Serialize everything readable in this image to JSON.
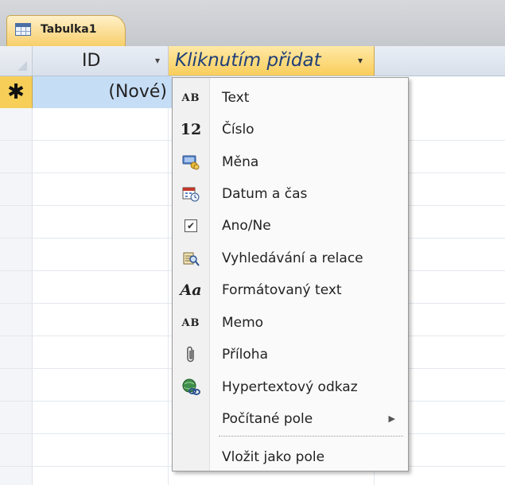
{
  "tab": {
    "label": "Tabulka1",
    "icon": "table-icon"
  },
  "header": {
    "id_label": "ID",
    "add_label": "Kliknutím přidat",
    "arrow": "▾"
  },
  "new_row": {
    "marker": "✱",
    "value": "(Nové)"
  },
  "menu": {
    "items": [
      {
        "label": "Text",
        "icon": "text-type-icon",
        "glyph": "AB"
      },
      {
        "label": "Číslo",
        "icon": "number-type-icon",
        "glyph": "12"
      },
      {
        "label": "Měna",
        "icon": "currency-icon",
        "glyph": "💳"
      },
      {
        "label": "Datum a čas",
        "icon": "calendar-clock-icon",
        "glyph": "📅"
      },
      {
        "label": "Ano/Ne",
        "icon": "checkbox-icon",
        "glyph": "✔"
      },
      {
        "label": "Vyhledávání a relace",
        "icon": "lookup-icon",
        "glyph": "🔍"
      },
      {
        "label": "Formátovaný text",
        "icon": "rich-text-icon",
        "glyph": "Aa"
      },
      {
        "label": "Memo",
        "icon": "memo-icon",
        "glyph": "AB"
      },
      {
        "label": "Příloha",
        "icon": "paperclip-icon",
        "glyph": "📎"
      },
      {
        "label": "Hypertextový odkaz",
        "icon": "hyperlink-icon",
        "glyph": "🔗"
      },
      {
        "label": "Počítané pole",
        "icon": "",
        "glyph": "",
        "submenu_arrow": "▶"
      },
      {
        "label": "Vložit jako pole",
        "icon": "",
        "glyph": ""
      }
    ]
  }
}
